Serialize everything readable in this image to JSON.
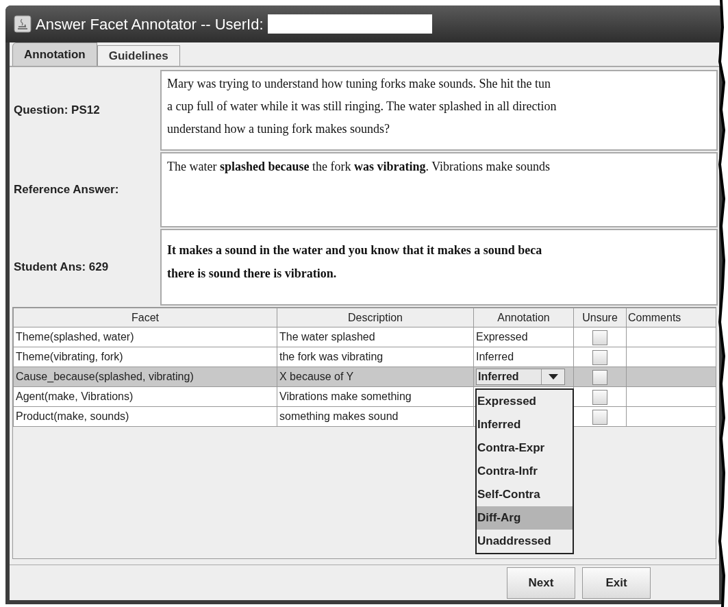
{
  "window": {
    "title": "Answer Facet Annotator -- UserId:"
  },
  "tabs": [
    {
      "label": "Annotation",
      "selected": true
    },
    {
      "label": "Guidelines",
      "selected": false
    }
  ],
  "question": {
    "label": "Question: PS12",
    "text": "Mary was trying to understand how tuning forks make sounds. She hit the tun\na cup full of water while it was still ringing. The water splashed in all direction\nunderstand how a tuning fork makes sounds?"
  },
  "reference_answer": {
    "label": "Reference Answer:",
    "text": "The water **splashed because** the fork **was vibrating**. Vibrations make sounds"
  },
  "student_answer": {
    "label": "Student Ans: 629",
    "text": "It makes a sound in the water and you know that it makes a sound beca\nthere is sound there is vibration."
  },
  "table": {
    "columns": [
      "Facet",
      "Description",
      "Annotation",
      "Unsure",
      "Comments"
    ],
    "rows": [
      {
        "facet": "Theme(splashed, water)",
        "description": "The water splashed",
        "annotation": "Expressed",
        "unsure": false,
        "selected": false
      },
      {
        "facet": "Theme(vibrating, fork)",
        "description": "the fork was vibrating",
        "annotation": "Inferred",
        "unsure": false,
        "selected": false
      },
      {
        "facet": "Cause_because(splashed, vibrating)",
        "description": "X because of Y",
        "annotation": "Inferred",
        "unsure": false,
        "selected": true,
        "editing": true
      },
      {
        "facet": "Agent(make, Vibrations)",
        "description": "Vibrations make something",
        "unsure": false,
        "selected": false
      },
      {
        "facet": "Product(make, sounds)",
        "description": "something makes sound",
        "unsure": false,
        "selected": false
      }
    ]
  },
  "dropdown": {
    "options": [
      {
        "label": "Expressed",
        "selected": false
      },
      {
        "label": "Inferred",
        "selected": false
      },
      {
        "label": "Contra-Expr",
        "selected": false
      },
      {
        "label": "Contra-Infr",
        "selected": false
      },
      {
        "label": "Self-Contra",
        "selected": false
      },
      {
        "label": "Diff-Arg",
        "selected": true
      },
      {
        "label": "Unaddressed",
        "selected": false
      }
    ]
  },
  "buttons": [
    {
      "label": "Next"
    },
    {
      "label": "Exit"
    }
  ]
}
